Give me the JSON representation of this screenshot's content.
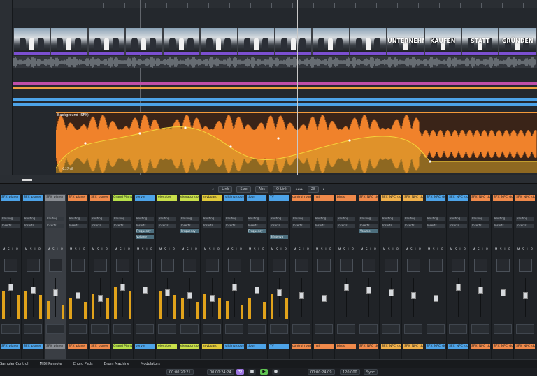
{
  "arrange": {
    "video_captions": [
      "",
      "",
      "",
      "",
      "",
      "",
      "",
      "",
      "",
      "",
      "UNTERNEHMEN",
      "KAUFEN",
      "STATT",
      "GRÜNDEN"
    ],
    "clip_label": "Background (SFX)",
    "gain_label": "-0.27 dB",
    "colors": {
      "video_border": "#7b4fd0",
      "clip_fill": "#f0822b",
      "clip_env": "#f5d23a",
      "stripe_pink": "#c04ea8",
      "stripe_orange": "#f0a040",
      "stripe_blue": "#4da3e8"
    }
  },
  "toolbar": {
    "link_label": "Link",
    "size_label": "Size",
    "abs_label": "Abs",
    "olink_label": "O-Link",
    "count_value": "28"
  },
  "mixer": {
    "channels": [
      {
        "name": "SFX_player_fo",
        "color": "#4da3e8",
        "bottom": "SFX_player_"
      },
      {
        "name": "SFX_player_fo",
        "color": "#4da3e8",
        "bottom": "SFX_player_footsteps_"
      },
      {
        "name": "SFX_player_fo",
        "color": "#8a8e94",
        "bottom": "SFX_player_footsteps_"
      },
      {
        "name": "SFX_player_fo",
        "color": "#f08a4b",
        "bottom": "SFX_player_footsteps_"
      },
      {
        "name": "SFX_player_fo",
        "color": "#f08a4b",
        "bottom": "SFX_player_footsteps_"
      },
      {
        "name": "Grand Piano",
        "color": "#b7e04a",
        "bottom": "Grand Piano"
      },
      {
        "name": "server",
        "color": "#4da3e8",
        "bottom": "server"
      },
      {
        "name": "elevator",
        "color": "#c9e04a",
        "bottom": "elevator"
      },
      {
        "name": "elevator door",
        "color": "#c9e04a",
        "bottom": "elevator door"
      },
      {
        "name": "keyboard",
        "color": "#e0c93a",
        "bottom": "keyboard"
      },
      {
        "name": "sliding doors",
        "color": "#4da3e8",
        "bottom": "sliding doors"
      },
      {
        "name": "door",
        "color": "#4da3e8",
        "bottom": "door"
      },
      {
        "name": "TV",
        "color": "#4da3e8",
        "bottom": "TV"
      },
      {
        "name": "control room",
        "color": "#f08a4b",
        "bottom": "control room"
      },
      {
        "name": "hall",
        "color": "#f08a4b",
        "bottom": "hall"
      },
      {
        "name": "birds",
        "color": "#f08a4b",
        "bottom": "birds"
      },
      {
        "name": "SFX_NPC_dog",
        "color": "#f08a4b",
        "bottom": "SFX_NPC_dog_barking"
      },
      {
        "name": "SFX_NPC_dog",
        "color": "#f0b04b",
        "bottom": "SFX_NPC_dog_footsteps_left"
      },
      {
        "name": "SFX_NPC_dog",
        "color": "#f0b04b",
        "bottom": "SFX_NPC_dog_footsteps_right"
      },
      {
        "name": "SFX_NPC_dog",
        "color": "#4da3e8",
        "bottom": "SFX_NPC_dog_footsteps_left"
      },
      {
        "name": "SFX_NPC_dog",
        "color": "#4da3e8",
        "bottom": "SFX_NPC_dog_footsteps_right"
      },
      {
        "name": "SFX_NPC_dog",
        "color": "#f08a4b",
        "bottom": "SFX_NPC_dog_footsteps_left"
      },
      {
        "name": "SFX_NPC_dog",
        "color": "#f08a4b",
        "bottom": "SFX_NPC_dog_footsteps_right"
      },
      {
        "name": "SFX_NPC_dog",
        "color": "#f08a4b",
        "bottom": "SFX_NPC_dog_footsteps_right"
      }
    ],
    "routing_label": "Routing",
    "inserts_label": "Inserts",
    "insert_names": {
      "6": "Frequency",
      "8": "Frequency",
      "11": "Frequency",
      "16": "Volume"
    },
    "insert_names2": {
      "6": "Volume",
      "12": "SEnterva"
    },
    "msl_labels": [
      "M",
      "S",
      "L",
      "R"
    ]
  },
  "tabs": [
    "Sampler Control",
    "MIDI Remote",
    "Chord Pads",
    "Drum Machine",
    "Modulators"
  ],
  "transport": {
    "time_left": "00:00:20:21",
    "time_mid": "00:00:24:24",
    "time_right": "00:00:24:09",
    "tempo": "120.000",
    "signature": "Sync"
  }
}
